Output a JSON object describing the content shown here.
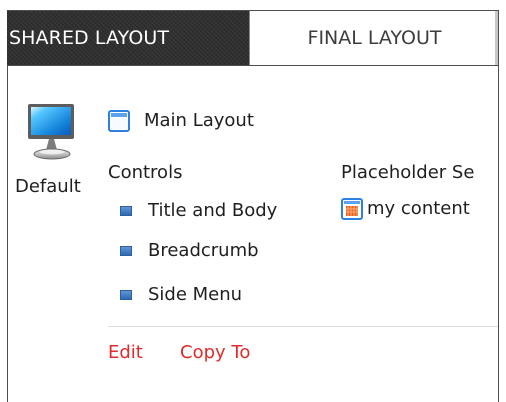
{
  "tabs": {
    "shared_label": "SHARED LAYOUT",
    "final_label": "FINAL LAYOUT"
  },
  "layout": {
    "default_label": "Default",
    "main_layout_label": "Main Layout",
    "controls_heading": "Controls",
    "controls": [
      {
        "label": "Title and Body"
      },
      {
        "label": "Breadcrumb"
      },
      {
        "label": "Side Menu"
      }
    ],
    "placeholder_heading": "Placeholder Se",
    "placeholder_items": [
      {
        "label": "my content"
      }
    ]
  },
  "actions": {
    "edit_label": "Edit",
    "copy_to_label": "Copy To"
  },
  "icons": {
    "default_device": "monitor-icon",
    "main_layout": "window-layout-icon",
    "control_item": "control-chip-icon",
    "placeholder_item": "placeholder-grid-icon"
  },
  "colors": {
    "active_tab_background": "#2f2f2f",
    "action_link": "#e12b2b",
    "control_icon": "#2f6ab6",
    "placeholder_icon_accent": "#e85f1f"
  }
}
